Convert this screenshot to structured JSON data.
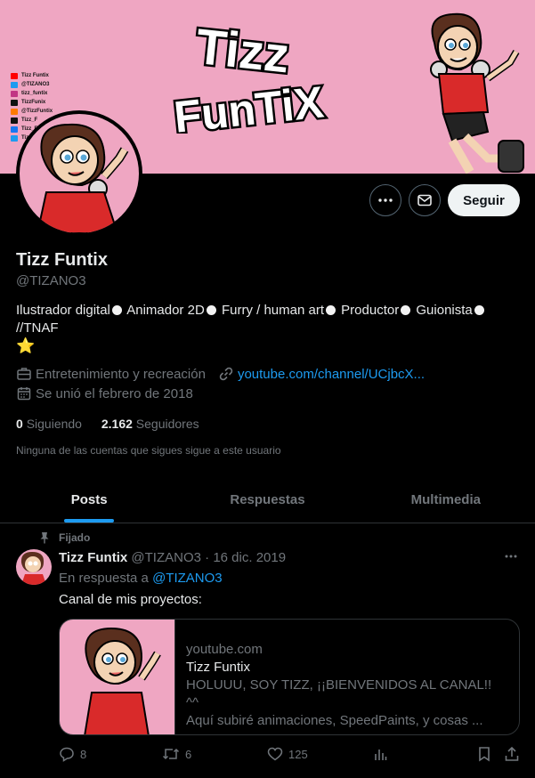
{
  "banner": {
    "logo_line1": "Tizz",
    "logo_line2": "FunTiX",
    "socials": [
      {
        "text": "Tizz Funtix",
        "color": "#ff0000"
      },
      {
        "text": "@TIZANO3",
        "color": "#1d9bf0"
      },
      {
        "text": "tizz_funtix",
        "color": "#c13584"
      },
      {
        "text": "TizzFunix",
        "color": "#111111"
      },
      {
        "text": "@TizzFuntix",
        "color": "#ff7a00"
      },
      {
        "text": "Tizz_F",
        "color": "#111111"
      },
      {
        "text": "Tizz_F",
        "color": "#1877f2"
      },
      {
        "text": "Tizz_F",
        "color": "#1d9bf0"
      }
    ]
  },
  "profile": {
    "name": "Tizz Funtix",
    "handle": "@TIZANO3",
    "bio_parts": [
      "Ilustrador digital",
      "Animador 2D",
      "Furry / human art",
      "Productor",
      "Guionista",
      "//TNAF"
    ],
    "bio_emoji": "⭐",
    "category": "Entretenimiento y recreación",
    "website": "youtube.com/channel/UCjbcX...",
    "joined": "Se unió el febrero de 2018",
    "following_count": "0",
    "following_label": "Siguiendo",
    "followers_count": "2.162",
    "followers_label": "Seguidores",
    "mutuals_note": "Ninguna de las cuentas que sigues sigue a este usuario"
  },
  "buttons": {
    "follow": "Seguir"
  },
  "tabs": [
    {
      "label": "Posts",
      "active": true
    },
    {
      "label": "Respuestas",
      "active": false
    },
    {
      "label": "Multimedia",
      "active": false
    }
  ],
  "post": {
    "pinned_label": "Fijado",
    "author": "Tizz Funtix",
    "handle": "@TIZANO3",
    "separator": "·",
    "date": "16 dic. 2019",
    "reply_prefix": "En respuesta a",
    "reply_handle": "@TIZANO3",
    "text": "Canal de mis proyectos:",
    "card": {
      "domain": "youtube.com",
      "title": "Tizz Funtix",
      "desc_line1": "HOLUUU, SOY TIZZ, ¡¡BIENVENIDOS AL CANAL!! ^^",
      "desc_line2": "Aquí subiré animaciones, SpeedPaints, y cosas ..."
    },
    "replies": "8",
    "reposts": "6",
    "likes": "125"
  },
  "colors": {
    "accent": "#1d9bf0",
    "banner_pink": "#efa6c2",
    "muted": "#71767b"
  }
}
